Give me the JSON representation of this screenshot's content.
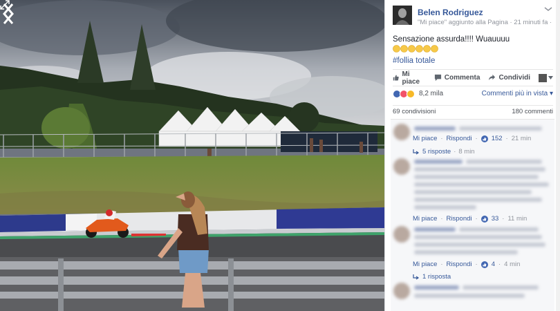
{
  "post": {
    "author": "Belen Rodriguez",
    "meta": "\"Mi piace\" aggiunto alla Pagina · 21 minuti fa ·",
    "text": "Sensazione assurda!!!! Wuauuuu",
    "hashtag": "#follia totale",
    "emoji_count": 6
  },
  "actions": {
    "like": "Mi piace",
    "comment": "Commenta",
    "share": "Condividi"
  },
  "reactions": {
    "count": "8,2 mila",
    "sort_label": "Commenti più in vista",
    "shares": "69 condivisioni",
    "comments_total": "180 commenti",
    "colors": {
      "like": "#4267b2",
      "love": "#f25268",
      "wow": "#f7b928"
    }
  },
  "comments": [
    {
      "like_label": "Mi piace",
      "reply_label": "Rispondi",
      "likes": "152",
      "time": "21 min",
      "replies": "5 risposte",
      "replies_time": "8 min"
    },
    {
      "like_label": "Mi piace",
      "reply_label": "Rispondi",
      "likes": "33",
      "time": "11 min"
    },
    {
      "like_label": "Mi piace",
      "reply_label": "Rispondi",
      "likes": "4",
      "time": "4 min",
      "replies": "1 risposta"
    }
  ],
  "icons": {
    "expand": "expand-icon",
    "prev": "chevron-left-icon",
    "next": "chevron-right-icon",
    "more": "more-icon"
  }
}
